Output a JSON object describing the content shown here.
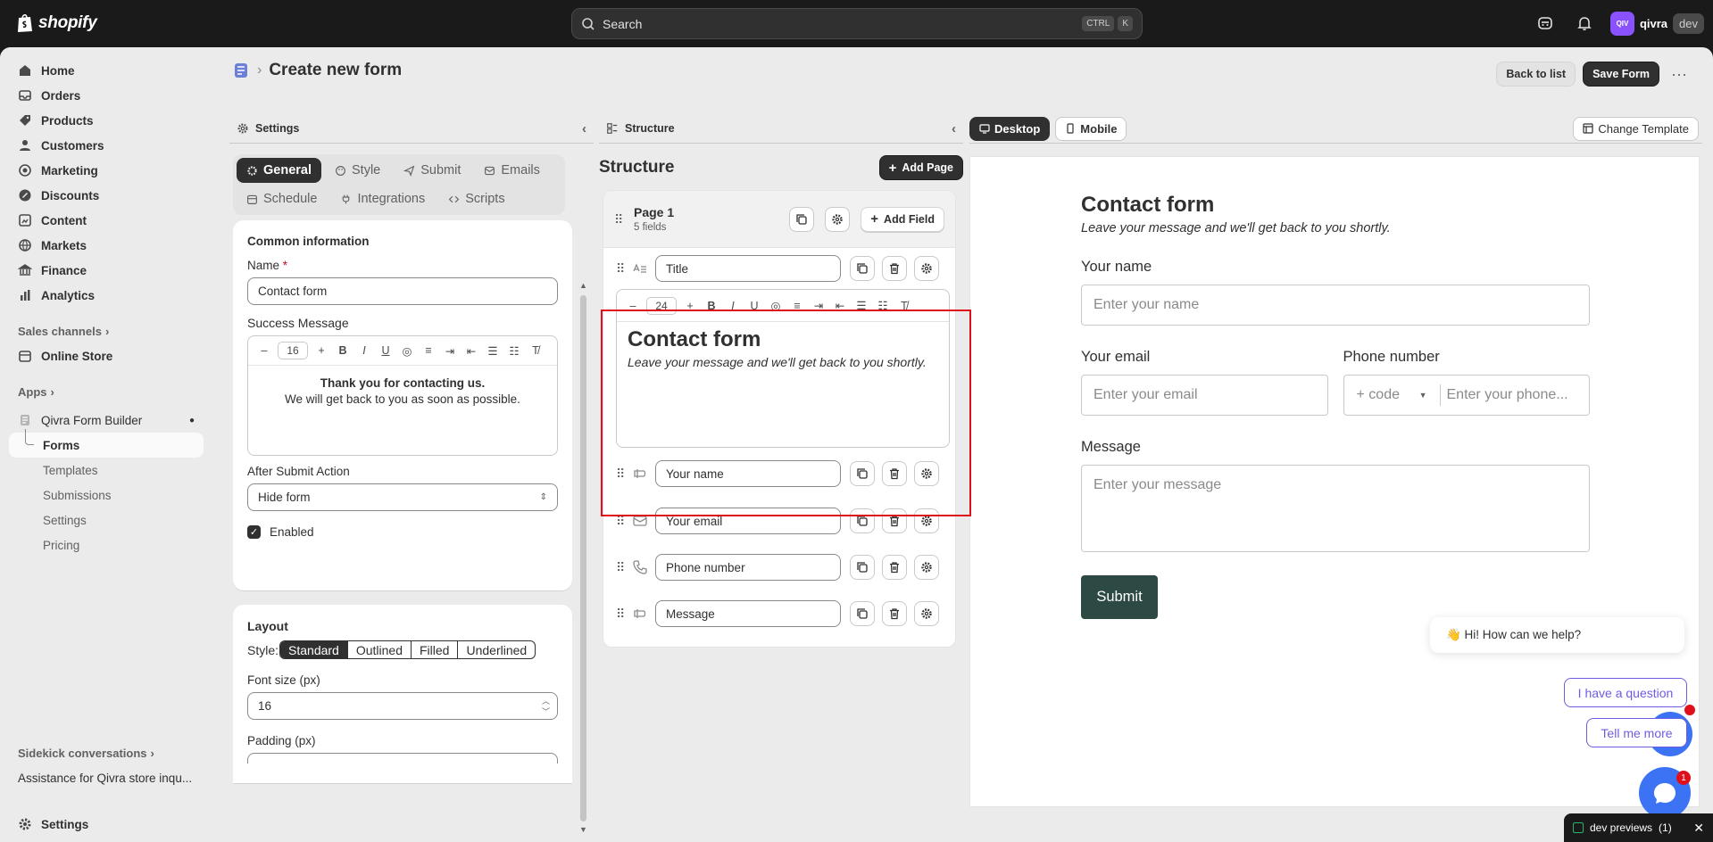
{
  "topbar": {
    "brand": "shopify",
    "search_placeholder": "Search",
    "search_keys": [
      "CTRL",
      "K"
    ],
    "store_initials": "QIV",
    "store_name": "qivra",
    "store_env": "dev"
  },
  "sidebar": {
    "items": [
      {
        "label": "Home",
        "icon": "home-icon"
      },
      {
        "label": "Orders",
        "icon": "orders-icon"
      },
      {
        "label": "Products",
        "icon": "tag-icon"
      },
      {
        "label": "Customers",
        "icon": "person-icon"
      },
      {
        "label": "Marketing",
        "icon": "target-icon"
      },
      {
        "label": "Discounts",
        "icon": "discount-icon"
      },
      {
        "label": "Content",
        "icon": "content-icon"
      },
      {
        "label": "Markets",
        "icon": "globe-icon"
      },
      {
        "label": "Finance",
        "icon": "bank-icon"
      },
      {
        "label": "Analytics",
        "icon": "chart-icon"
      }
    ],
    "sales_channels_label": "Sales channels",
    "online_store": "Online Store",
    "apps_label": "Apps",
    "app_name": "Qivra Form Builder",
    "app_items": [
      "Forms",
      "Templates",
      "Submissions",
      "Settings",
      "Pricing"
    ],
    "sidekick_label": "Sidekick conversations",
    "sidekick_item": "Assistance for Qivra store inqu...",
    "settings": "Settings"
  },
  "header": {
    "title": "Create new form",
    "back_button": "Back to list",
    "save_button": "Save Form",
    "more": "···"
  },
  "settings_panel": {
    "title": "Settings",
    "tabs": [
      "General",
      "Style",
      "Submit",
      "Emails",
      "Schedule",
      "Integrations",
      "Scripts"
    ],
    "common_info": "Common information",
    "name_label": "Name",
    "required_mark": "*",
    "name_value": "Contact form",
    "success_label": "Success Message",
    "font_size_toolbar": "16",
    "success_line1": "Thank you for contacting us.",
    "success_line2": "We will get back to you as soon as possible.",
    "after_submit_label": "After Submit Action",
    "after_submit_value": "Hide form",
    "enabled_label": "Enabled",
    "layout_title": "Layout",
    "style_label": "Style:",
    "style_options": [
      "Standard",
      "Outlined",
      "Filled",
      "Underlined"
    ],
    "style_selected": "Standard",
    "font_size_label": "Font size (px)",
    "font_size_value": "16",
    "padding_label": "Padding (px)"
  },
  "structure_panel": {
    "title": "Structure",
    "heading": "Structure",
    "add_page": "Add Page",
    "page_name": "Page 1",
    "page_fields": "5 fields",
    "add_field": "Add Field",
    "title_field": "Title",
    "editor_font_size": "24",
    "editor_heading": "Contact form",
    "editor_desc": "Leave your message and we'll get back to you shortly.",
    "fields": [
      {
        "label": "Your name",
        "icon": "text-field-icon"
      },
      {
        "label": "Your email",
        "icon": "email-icon"
      },
      {
        "label": "Phone number",
        "icon": "phone-icon"
      },
      {
        "label": "Message",
        "icon": "text-field-icon"
      }
    ]
  },
  "preview": {
    "desktop_tab": "Desktop",
    "mobile_tab": "Mobile",
    "change_template": "Change Template",
    "form_title": "Contact form",
    "form_desc": "Leave your message and we'll get back to you shortly.",
    "name_label": "Your name",
    "name_placeholder": "Enter your name",
    "email_label": "Your email",
    "email_placeholder": "Enter your email",
    "phone_label": "Phone number",
    "phone_code": "+ code",
    "phone_placeholder": "Enter your phone...",
    "message_label": "Message",
    "message_placeholder": "Enter your message",
    "submit": "Submit"
  },
  "chat": {
    "greeting": "👋 Hi! How can we help?",
    "option1": "I have a question",
    "option2": "Tell me more",
    "badge": "1"
  },
  "devbar": {
    "label": "dev previews",
    "count": "(1)"
  },
  "colors": {
    "accent_dark": "#303030",
    "submit_bg": "#2c4a43",
    "highlight": "#e0101b",
    "chat_blue": "#3c73f5"
  }
}
